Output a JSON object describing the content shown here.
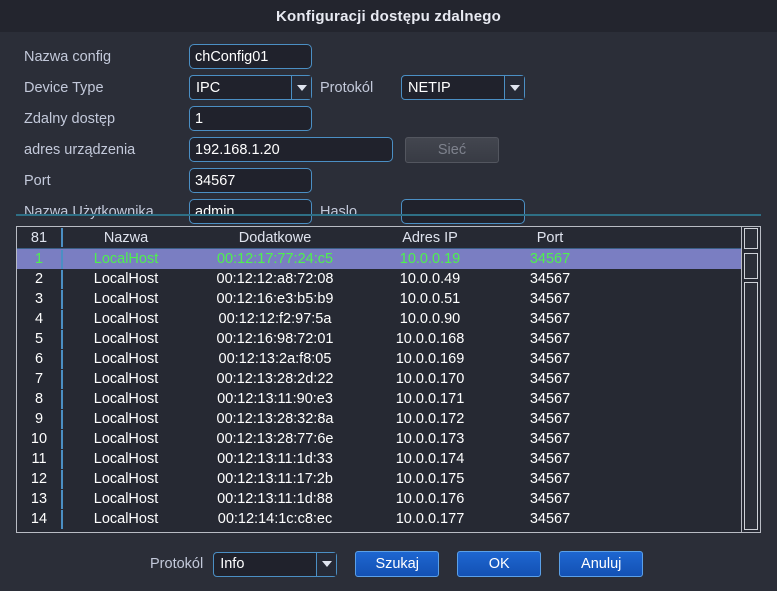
{
  "window": {
    "title": "Konfiguracji dostępu zdalnego"
  },
  "form": {
    "config_name": {
      "label": "Nazwa config",
      "value": "chConfig01"
    },
    "device_type": {
      "label": "Device Type",
      "value": "IPC"
    },
    "protocol": {
      "label": "Protokól",
      "value": "NETIP"
    },
    "remote_access": {
      "label": "Zdalny dostęp",
      "value": "1"
    },
    "device_address": {
      "label": "adres urządzenia",
      "value": "192.168.1.20"
    },
    "network_button": {
      "label": "Sieć"
    },
    "port": {
      "label": "Port",
      "value": "34567"
    },
    "username": {
      "label": "Nazwa Użytkownika",
      "value": "admin"
    },
    "password": {
      "label": "Haslo",
      "value": ""
    }
  },
  "table": {
    "headers": {
      "count": "81",
      "name": "Nazwa",
      "extra": "Dodatkowe",
      "ip": "Adres IP",
      "port": "Port"
    },
    "selected_index": 0,
    "rows": [
      {
        "idx": "1",
        "name": "LocalHost",
        "extra": "00:12:17:77:24:c5",
        "ip": "10.0.0.19",
        "port": "34567"
      },
      {
        "idx": "2",
        "name": "LocalHost",
        "extra": "00:12:12:a8:72:08",
        "ip": "10.0.0.49",
        "port": "34567"
      },
      {
        "idx": "3",
        "name": "LocalHost",
        "extra": "00:12:16:e3:b5:b9",
        "ip": "10.0.0.51",
        "port": "34567"
      },
      {
        "idx": "4",
        "name": "LocalHost",
        "extra": "00:12:12:f2:97:5a",
        "ip": "10.0.0.90",
        "port": "34567"
      },
      {
        "idx": "5",
        "name": "LocalHost",
        "extra": "00:12:16:98:72:01",
        "ip": "10.0.0.168",
        "port": "34567"
      },
      {
        "idx": "6",
        "name": "LocalHost",
        "extra": "00:12:13:2a:f8:05",
        "ip": "10.0.0.169",
        "port": "34567"
      },
      {
        "idx": "7",
        "name": "LocalHost",
        "extra": "00:12:13:28:2d:22",
        "ip": "10.0.0.170",
        "port": "34567"
      },
      {
        "idx": "8",
        "name": "LocalHost",
        "extra": "00:12:13:11:90:e3",
        "ip": "10.0.0.171",
        "port": "34567"
      },
      {
        "idx": "9",
        "name": "LocalHost",
        "extra": "00:12:13:28:32:8a",
        "ip": "10.0.0.172",
        "port": "34567"
      },
      {
        "idx": "10",
        "name": "LocalHost",
        "extra": "00:12:13:28:77:6e",
        "ip": "10.0.0.173",
        "port": "34567"
      },
      {
        "idx": "11",
        "name": "LocalHost",
        "extra": "00:12:13:11:1d:33",
        "ip": "10.0.0.174",
        "port": "34567"
      },
      {
        "idx": "12",
        "name": "LocalHost",
        "extra": "00:12:13:11:17:2b",
        "ip": "10.0.0.175",
        "port": "34567"
      },
      {
        "idx": "13",
        "name": "LocalHost",
        "extra": "00:12:13:11:1d:88",
        "ip": "10.0.0.176",
        "port": "34567"
      },
      {
        "idx": "14",
        "name": "LocalHost",
        "extra": "00:12:14:1c:c8:ec",
        "ip": "10.0.0.177",
        "port": "34567"
      }
    ]
  },
  "footer": {
    "protocol_label": "Protokól",
    "protocol_value": "Info",
    "search_button": "Szukaj",
    "ok_button": "OK",
    "cancel_button": "Anuluj"
  },
  "colors": {
    "background": "#2b2e38",
    "titlebar": "#23252e",
    "input_border": "#4b8fc4",
    "selected_row_bg": "#7a7ec2",
    "selected_row_text": "#4ef14e",
    "button_blue": "#1e66d0",
    "separator": "#2e6f85"
  }
}
